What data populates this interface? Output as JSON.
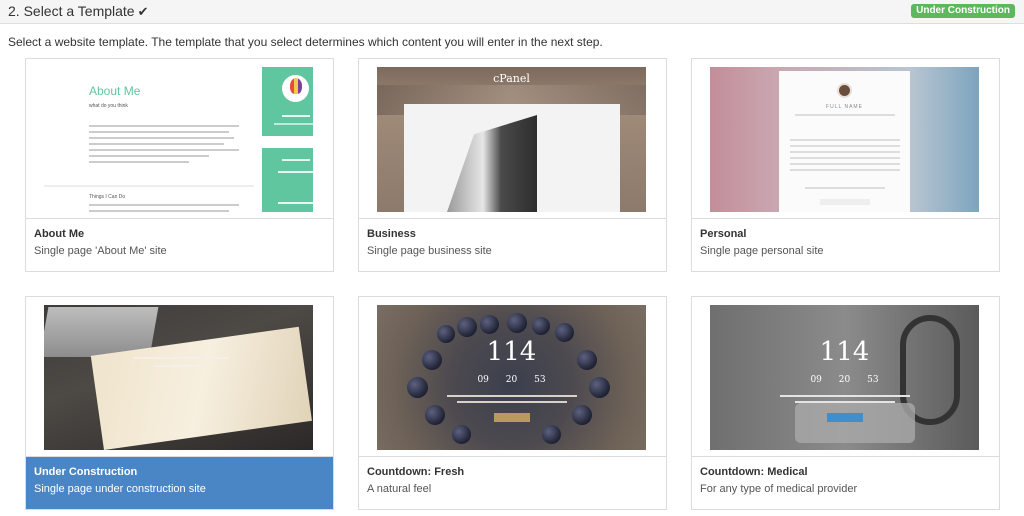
{
  "header": {
    "step_title": "2. Select a Template",
    "badge": "Under Construction"
  },
  "instructions": "Select a website template. The template that you select determines which content you will enter in the next step.",
  "templates": [
    {
      "name": "About Me",
      "description": "Single page 'About Me' site",
      "selected": false,
      "preview": {
        "title": "About Me",
        "subtitle": "what do you think",
        "section": "Things I Can Do"
      }
    },
    {
      "name": "Business",
      "description": "Single page business site",
      "selected": false,
      "preview": {
        "logo": "cPanel"
      }
    },
    {
      "name": "Personal",
      "description": "Single page personal site",
      "selected": false,
      "preview": {
        "heading": "FULL NAME"
      }
    },
    {
      "name": "Under Construction",
      "description": "Single page under construction site",
      "selected": true,
      "preview": {}
    },
    {
      "name": "Countdown: Fresh",
      "description": "A natural feel",
      "selected": false,
      "preview": {
        "days": "114",
        "hours": "09",
        "minutes": "20",
        "seconds": "53"
      }
    },
    {
      "name": "Countdown: Medical",
      "description": "For any type of medical provider",
      "selected": false,
      "preview": {
        "days": "114",
        "hours": "09",
        "minutes": "20",
        "seconds": "53"
      }
    }
  ],
  "colors": {
    "selected_caption": "#4a86c5",
    "badge": "#5cb85c",
    "about_me_accent": "#5fc6a0"
  }
}
